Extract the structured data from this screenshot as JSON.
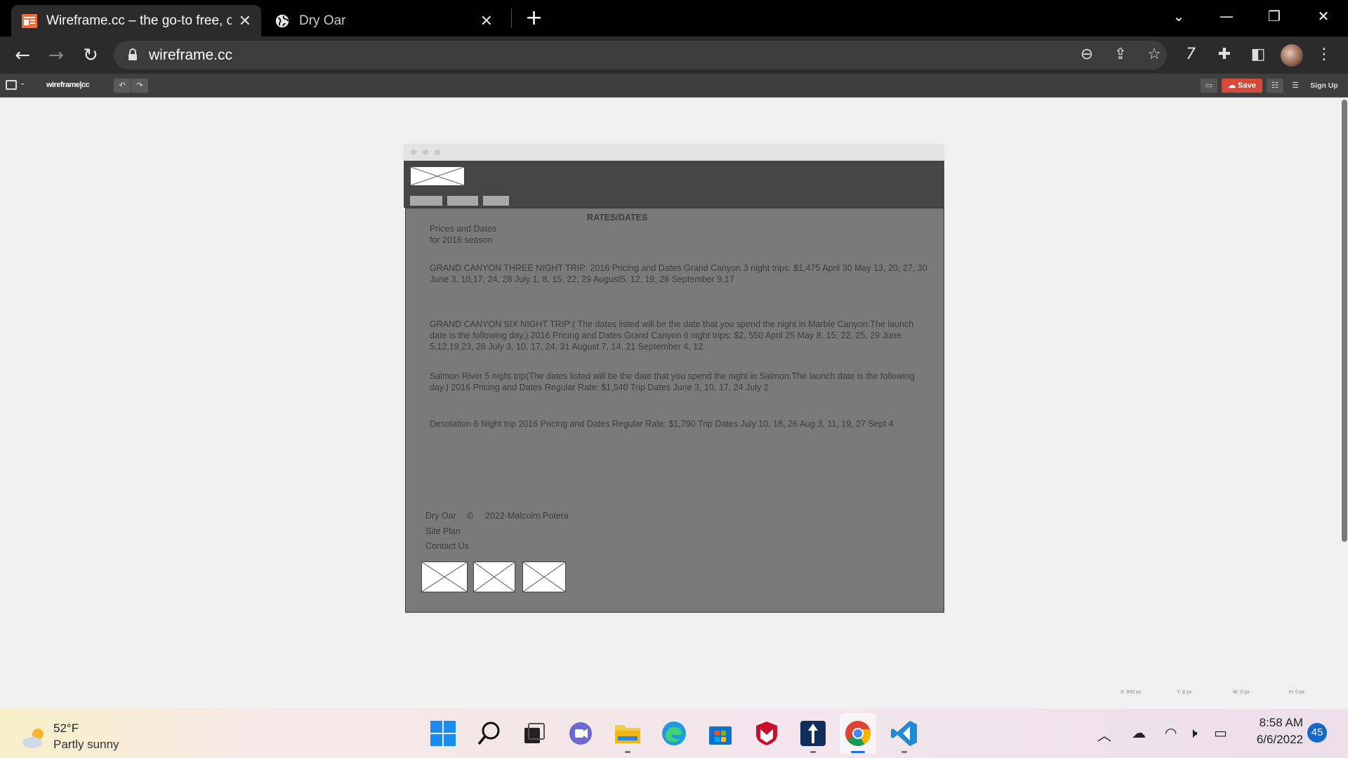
{
  "browser": {
    "tabs": [
      {
        "title": "Wireframe.cc – the go-to free, on",
        "active": true
      },
      {
        "title": "Dry Oar",
        "active": false
      }
    ],
    "url": "wireframe.cc",
    "extension_badge": "7"
  },
  "app": {
    "logo": "wireframe|cc",
    "save_label": "Save",
    "signup_label": "Sign Up"
  },
  "wireframe": {
    "content_heading": "RATES/DATES",
    "intro_line1": "Prices and Dates",
    "intro_line2": "for 2016 season",
    "trips": [
      "GRAND CANYON THREE NIGHT TRIP: 2016 Pricing and Dates Grand Canyon 3 night trips: $1,475 April 30 May 13, 20, 27, 30 June 3, 10,17, 24, 28 July 1, 8, 15, 22, 29 August5, 12, 19, 26 September 9,17",
      "GRAND CANYON SIX NIGHT TRIP:( The dates listed will be the date that you spend the night in Marble Canyon.The launch date is the following day.) 2016 Pricing and Dates Grand Canyon 6 night trips: $2, 550 April 25 May 8, 15, 22, 25, 29 June 5,12,19,23, 26 July 3, 10, 17, 24, 31 August 7, 14, 21 September 4, 12",
      "Salmon River 5 night trip(The dates listed will be the date that you spend the night in Salmon.The launch date is the following day.) 2016 Pricing and Dates Regular Rate: $1,540 Trip Dates June 3, 10, 17, 24 July 2",
      "Desolation 6 Night trip 2016 Pricing and Dates Regular Rate: $1,790 Trip Dates July 10, 18, 26 Aug 3, 11, 19, 27 Sept 4"
    ],
    "footer": {
      "brand": "Dry Oar",
      "copyright_symbol": "©",
      "copyright": "2022-Malcolm Potera",
      "site_plan": "Site Plan",
      "contact": "Contact Us"
    }
  },
  "status_coords": {
    "x": "X: 950 px",
    "y": "Y: 8 px",
    "w": "W: 0 px",
    "h": "H: 0 px"
  },
  "taskbar": {
    "temperature": "52°F",
    "condition": "Partly sunny",
    "time": "8:58 AM",
    "date": "6/6/2022",
    "notification_count": "45"
  }
}
